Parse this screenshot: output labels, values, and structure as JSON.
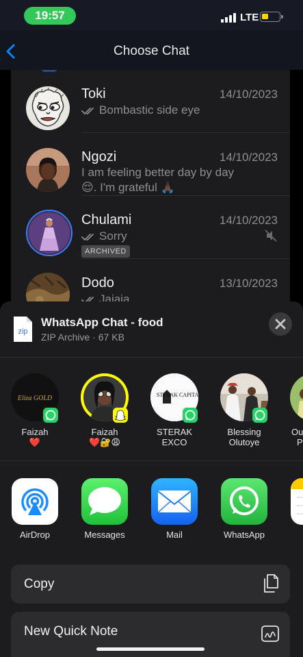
{
  "status_bar": {
    "time": "19:57",
    "network": "LTE"
  },
  "nav": {
    "title": "Choose Chat"
  },
  "chats": [
    {
      "name": "Toki",
      "date": "14/10/2023",
      "preview": "Bombastic side eye"
    },
    {
      "name": "Ngozi",
      "date": "14/10/2023",
      "preview_line1": "I am feeling better day by day",
      "preview_line2": "😌. I'm grateful 🙏🏿"
    },
    {
      "name": "Chulami",
      "date": "14/10/2023",
      "preview": "Sorry",
      "badge": "ARCHIVED"
    },
    {
      "name": "Dodo",
      "date": "13/10/2023",
      "preview": "Jajaja"
    }
  ],
  "share_sheet": {
    "file_title": "WhatsApp Chat - food",
    "file_subtitle": "ZIP Archive · 67 KB",
    "file_type": "zip",
    "contacts": [
      {
        "name": "Faizah",
        "sub": "❤️",
        "avatar_text": "Eliza GOLD",
        "app": "whatsapp"
      },
      {
        "name": "Faizah",
        "sub": "❤️🔐😩",
        "app": "snapchat"
      },
      {
        "name": "STERAK",
        "sub": "EXCO",
        "avatar_text": "STERAK CAPITAL",
        "app": "whatsapp"
      },
      {
        "name": "Blessing",
        "sub": "Olutoye",
        "app": "whatsapp"
      },
      {
        "name": "Ou",
        "sub": "P",
        "app": "whatsapp"
      }
    ],
    "apps": [
      {
        "label": "AirDrop"
      },
      {
        "label": "Messages"
      },
      {
        "label": "Mail"
      },
      {
        "label": "WhatsApp"
      }
    ],
    "actions": [
      {
        "label": "Copy"
      },
      {
        "label": "New Quick Note"
      }
    ]
  },
  "colors": {
    "accent_blue": "#0a84ff",
    "status_green": "#34c759",
    "whatsapp_green": "#25d366",
    "snapchat_yellow": "#fffc00"
  }
}
